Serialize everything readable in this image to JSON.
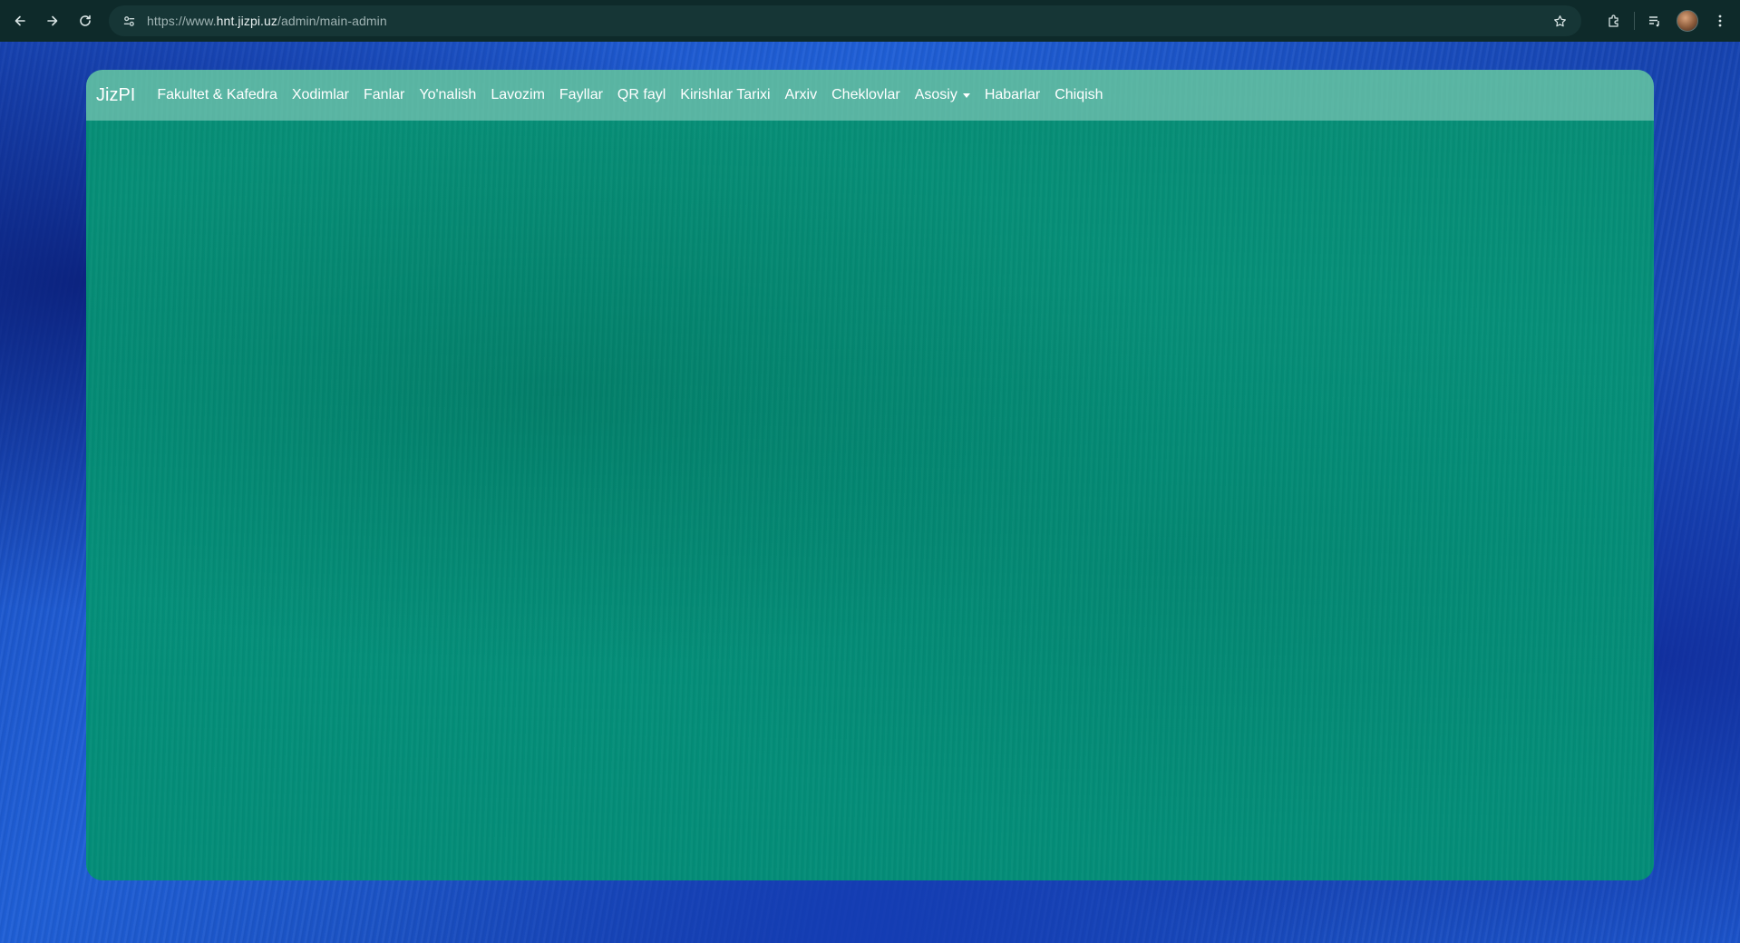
{
  "browser": {
    "url_prefix": "https://www.",
    "url_host": "hnt.jizpi.uz",
    "url_path": "/admin/main-admin"
  },
  "navbar": {
    "brand": "JizPI",
    "links": [
      "Fakultet & Kafedra",
      "Xodimlar",
      "Fanlar",
      "Yo'nalish",
      "Lavozim",
      "Fayllar",
      "QR fayl",
      "Kirishlar Tarixi",
      "Arxiv",
      "Cheklovlar"
    ],
    "dropdown_label": "Asosiy",
    "links_after": [
      "Habarlar",
      "Chiqish"
    ]
  },
  "colors": {
    "navbar_bg": "#8ccdbe",
    "card_bg": "#05907a",
    "page_bg": "#1f5fd6",
    "browser_bar": "#0e2a2a"
  },
  "icons": {
    "back": "arrow-left-icon",
    "forward": "arrow-right-icon",
    "reload": "reload-icon",
    "site_info": "tune-icon",
    "bookmark": "star-icon",
    "extensions": "puzzle-icon",
    "media": "playlist-icon",
    "menu": "kebab-menu-icon"
  }
}
